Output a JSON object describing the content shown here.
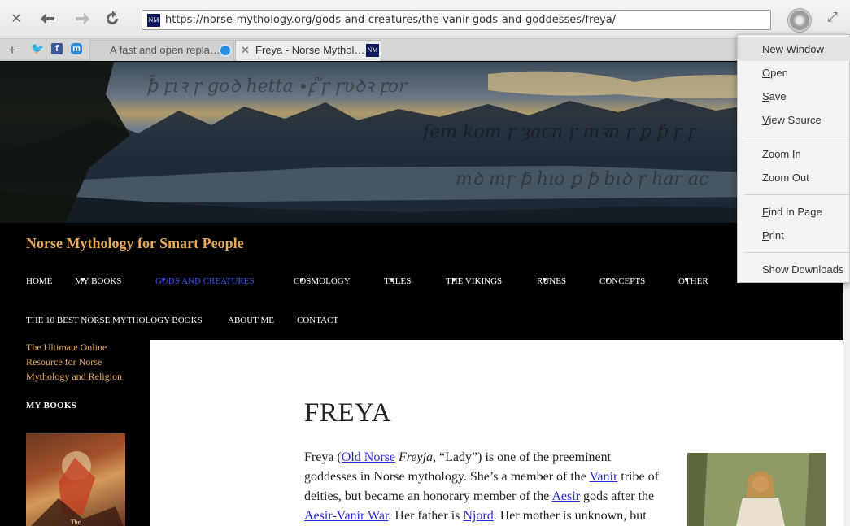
{
  "browser": {
    "url": "https://norse-mythology.org/gods-and-creatures/the-vanir-gods-and-goddesses/freya/",
    "favicon_text": "NM",
    "tabs": [
      {
        "label": "A fast and open repla…",
        "active": false
      },
      {
        "label": "Freya - Norse Mythol…",
        "active": true
      }
    ],
    "menu": {
      "items": [
        {
          "label": "New Window",
          "accel": "N",
          "rest": "ew Window"
        },
        {
          "label": "Open",
          "accel": "O",
          "rest": "pen"
        },
        {
          "label": "Save",
          "accel": "S",
          "rest": "ave"
        },
        {
          "label": "View Source",
          "accel": "V",
          "rest": "iew Source"
        },
        {
          "label": "Zoom In",
          "accel": "",
          "rest": "Zoom In"
        },
        {
          "label": "Zoom Out",
          "accel": "",
          "rest": "Zoom Out"
        },
        {
          "label": "Find In Page",
          "accel": "F",
          "rest": "ind In Page"
        },
        {
          "label": "Print",
          "accel": "P",
          "rest": "rint"
        },
        {
          "label": "Show Downloads",
          "accel": "",
          "rest": "Show Downloads"
        }
      ]
    }
  },
  "site": {
    "title": "Norse Mythology for Smart People",
    "tagline": "The Ultimate Online Resource for Norse Mythology and Religion",
    "nav_row1": [
      "HOME",
      "MY BOOKS",
      "GODS AND CREATURES",
      "COSMOLOGY",
      "TALES",
      "THE VIKINGS",
      "RUNES",
      "CONCEPTS",
      "OTHER"
    ],
    "nav_row2": [
      "THE 10 BEST NORSE MYTHOLOGY BOOKS",
      "ABOUT ME",
      "CONTACT"
    ],
    "sidebar_heading": "MY BOOKS",
    "book_cover_text": "The"
  },
  "article": {
    "title": "FREYA",
    "p1": "Freya (",
    "link_old_norse": "Old Norse",
    "p2": " ",
    "freyja": "Freyja",
    "p3": ", “Lady”) is one of the preeminent goddesses in Norse mythology. She’s a member of the ",
    "link_vanir": "Vanir",
    "p4": " tribe of deities, but became an honorary member of the ",
    "link_aesir": "Aesir",
    "p5": " gods after the ",
    "link_war": "Aesir-Vanir War",
    "p6": ". Her father is ",
    "link_njord": "Njord",
    "p7": ". Her mother is unknown, but could be"
  },
  "colors": {
    "accent_orange": "#e8a95a",
    "active_nav": "#3a54e8",
    "link": "#2a2ae0"
  }
}
